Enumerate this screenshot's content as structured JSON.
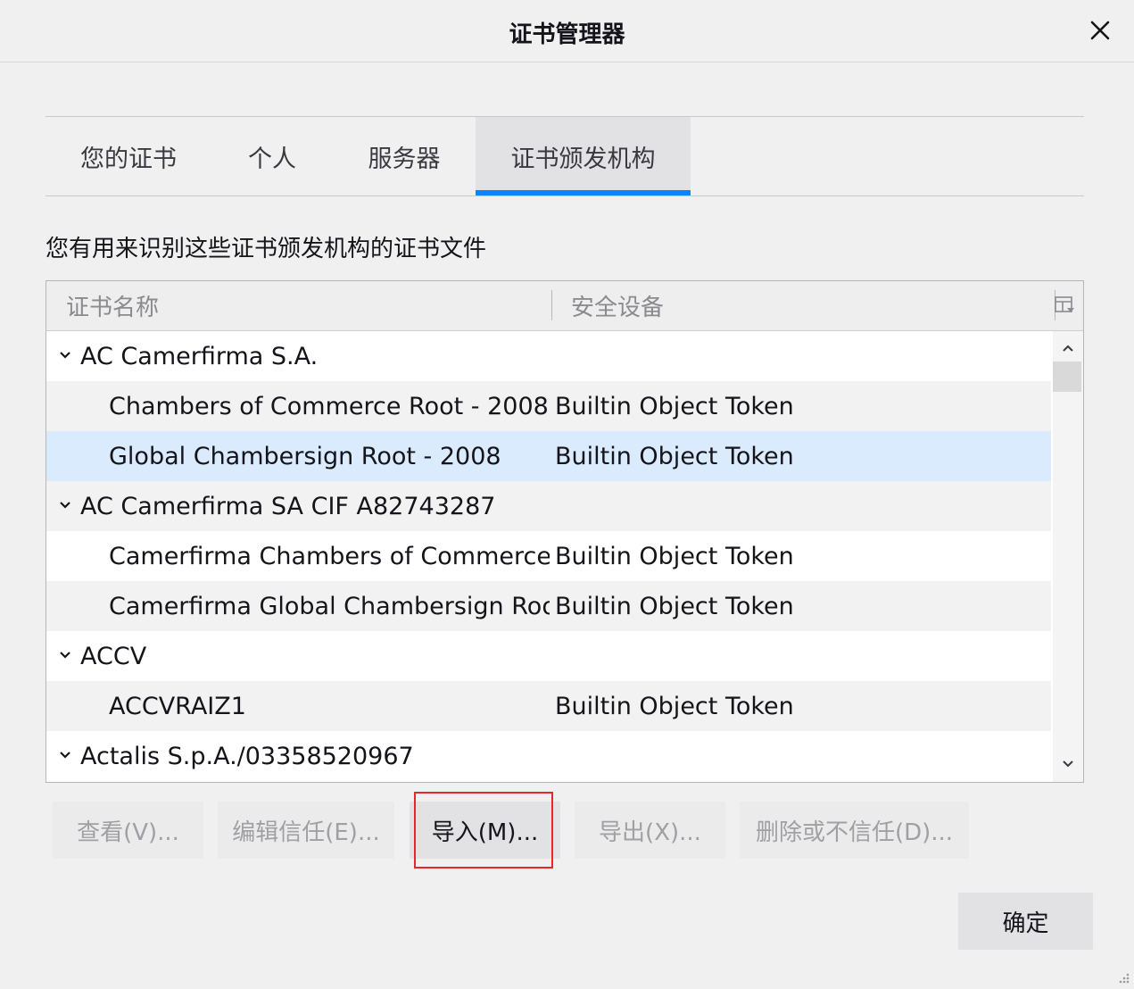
{
  "dialog": {
    "title": "证书管理器"
  },
  "tabs": [
    {
      "label": "您的证书",
      "selected": false
    },
    {
      "label": "个人",
      "selected": false
    },
    {
      "label": "服务器",
      "selected": false
    },
    {
      "label": "证书颁发机构",
      "selected": true
    }
  ],
  "description": "您有用来识别这些证书颁发机构的证书文件",
  "tree": {
    "columns": [
      "证书名称",
      "安全设备"
    ],
    "rows": [
      {
        "type": "group",
        "name": "AC Camerfirma S.A.",
        "device": ""
      },
      {
        "type": "item",
        "name": "Chambers of Commerce Root - 2008",
        "device": "Builtin Object Token"
      },
      {
        "type": "item",
        "name": "Global Chambersign Root - 2008",
        "device": "Builtin Object Token",
        "selected": true
      },
      {
        "type": "group",
        "name": "AC Camerfirma SA CIF A82743287",
        "device": ""
      },
      {
        "type": "item",
        "name": "Camerfirma Chambers of Commerce…",
        "device": "Builtin Object Token"
      },
      {
        "type": "item",
        "name": "Camerfirma Global Chambersign Root",
        "device": "Builtin Object Token"
      },
      {
        "type": "group",
        "name": "ACCV",
        "device": ""
      },
      {
        "type": "item",
        "name": "ACCVRAIZ1",
        "device": "Builtin Object Token"
      },
      {
        "type": "group",
        "name": "Actalis S.p.A./03358520967",
        "device": ""
      }
    ]
  },
  "actions": {
    "view": {
      "label": "查看(V)...",
      "mnemonic": "V"
    },
    "edit_trust": {
      "label": "编辑信任(E)...",
      "mnemonic": "E"
    },
    "import": {
      "label": "导入(M)...",
      "mnemonic": "M"
    },
    "export": {
      "label": "导出(X)...",
      "mnemonic": "X"
    },
    "delete": {
      "label": "删除或不信任(D)...",
      "mnemonic": "D"
    }
  },
  "ok_button": {
    "label": "确定"
  },
  "colors": {
    "accent": "#0a84ff",
    "selected_row": "#d9ebfd",
    "highlight": "#e8262b"
  }
}
